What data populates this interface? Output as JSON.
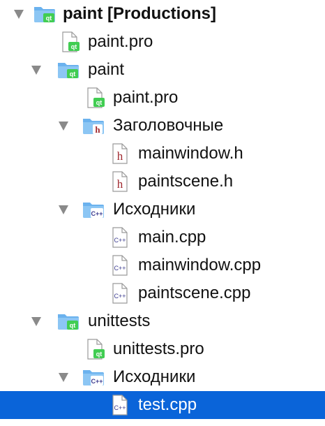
{
  "project_tree": {
    "items": [
      {
        "label": "paint [Productions]",
        "icon": "qt-folder-icon"
      },
      {
        "label": "paint.pro",
        "icon": "qt-pro-file-icon"
      },
      {
        "label": "paint",
        "icon": "qt-folder-icon"
      },
      {
        "label": "paint.pro",
        "icon": "qt-pro-file-icon"
      },
      {
        "label": "Заголовочные",
        "icon": "headers-folder-icon"
      },
      {
        "label": "mainwindow.h",
        "icon": "header-file-icon"
      },
      {
        "label": "paintscene.h",
        "icon": "header-file-icon"
      },
      {
        "label": "Исходники",
        "icon": "sources-folder-icon"
      },
      {
        "label": "main.cpp",
        "icon": "cpp-file-icon"
      },
      {
        "label": "mainwindow.cpp",
        "icon": "cpp-file-icon"
      },
      {
        "label": "paintscene.cpp",
        "icon": "cpp-file-icon"
      },
      {
        "label": "unittests",
        "icon": "qt-folder-icon"
      },
      {
        "label": "unittests.pro",
        "icon": "qt-pro-file-icon"
      },
      {
        "label": "Исходники",
        "icon": "sources-folder-icon"
      },
      {
        "label": "test.cpp",
        "icon": "cpp-file-icon"
      }
    ],
    "selected_item": "test.cpp"
  },
  "colors": {
    "selection": "#0a64d9",
    "folder": "#6bb2ee",
    "qt_green": "#41cd52",
    "header_red": "#a0282e",
    "cpp_purple": "#3b3b8f"
  }
}
